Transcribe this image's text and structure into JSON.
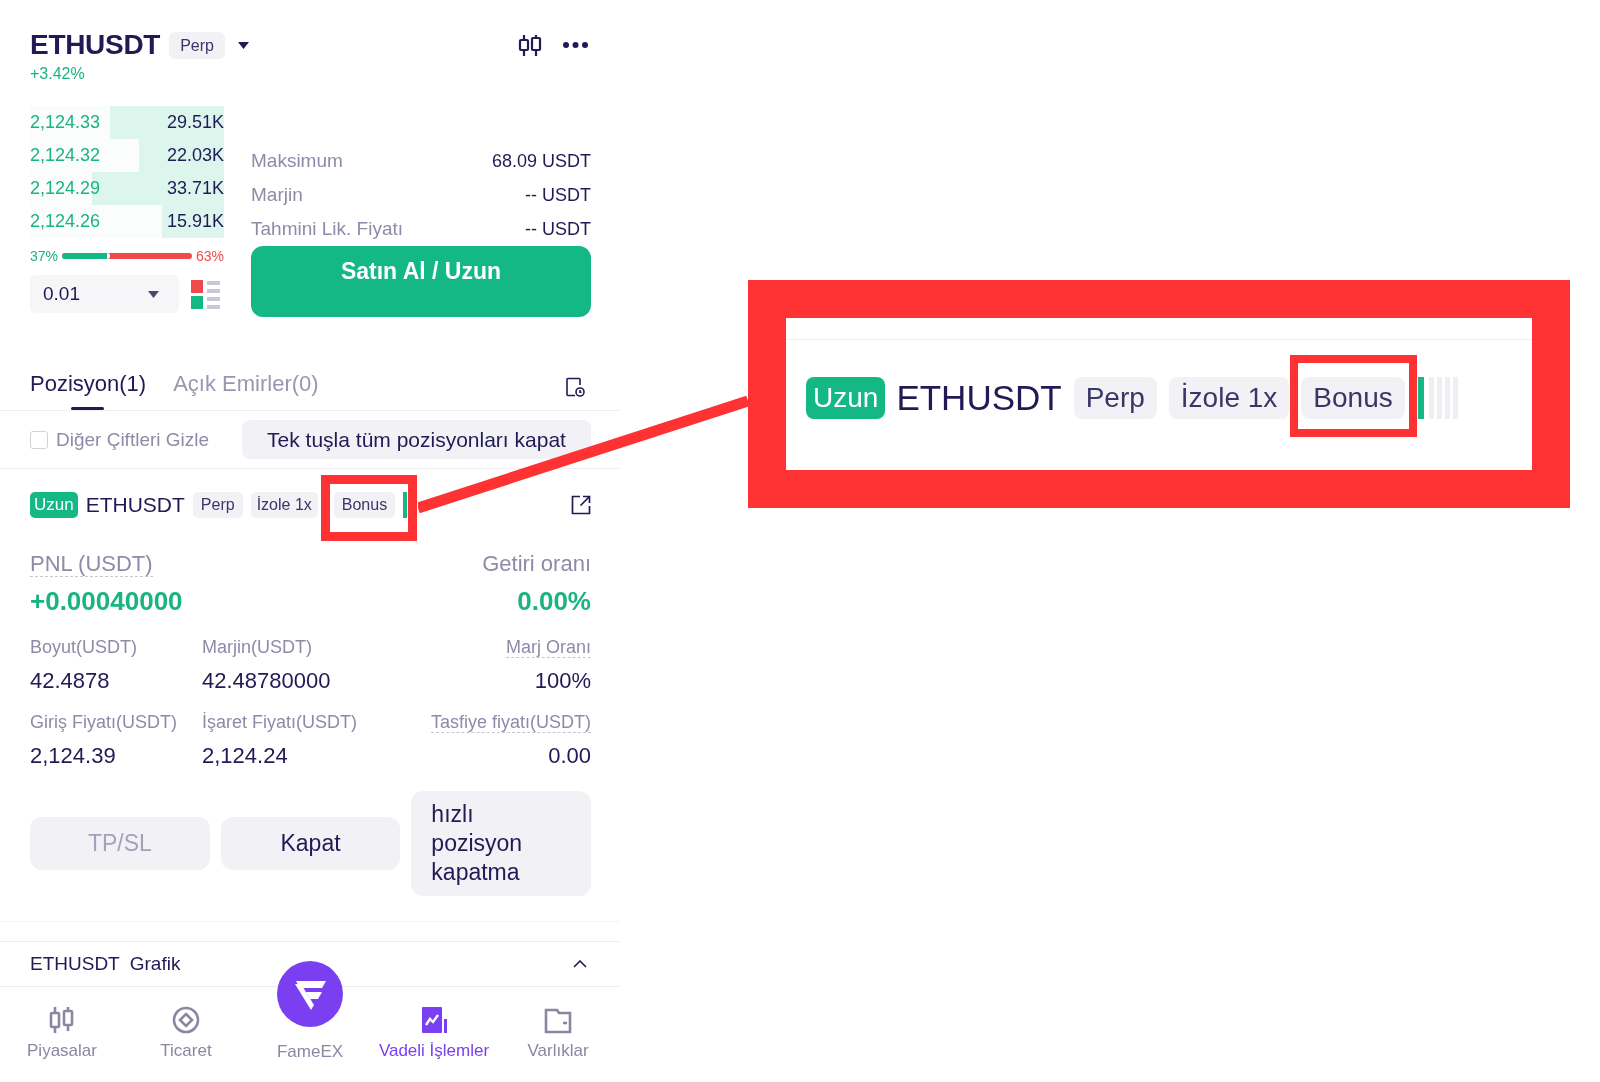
{
  "header": {
    "symbol": "ETHUSDT",
    "contract_tag": "Perp",
    "change": "+3.42%"
  },
  "order_book": {
    "rows": [
      {
        "price": "2,124.33",
        "amount": "29.51K",
        "level": 0.59
      },
      {
        "price": "2,124.32",
        "amount": "22.03K",
        "level": 0.44
      },
      {
        "price": "2,124.29",
        "amount": "33.71K",
        "level": 0.68
      },
      {
        "price": "2,124.26",
        "amount": "15.91K",
        "level": 0.32
      }
    ],
    "buy_share": "37%",
    "ratio_bar": {
      "level": 0.37
    },
    "sell_share": "63%",
    "precision": "0.01"
  },
  "order_form": {
    "rows": [
      {
        "label": "Maksimum",
        "value": "68.09 USDT"
      },
      {
        "label": "Marjin",
        "value": "-- USDT"
      },
      {
        "label": "Tahmini Lik. Fiyatı",
        "value": "-- USDT"
      }
    ],
    "submit_button": "Satın Al / Uzun"
  },
  "tabs": [
    {
      "label": "Pozisyon(1)",
      "selected": true
    },
    {
      "label": "Açık Emirler(0)",
      "selected": false
    }
  ],
  "hide_other_pairs": {
    "label": "Diğer Çiftleri Gizle",
    "checked": false
  },
  "close_all_button": "Tek tuşla tüm pozisyonları kapat",
  "position": {
    "side": "Uzun",
    "symbol": "ETHUSDT",
    "tags": [
      {
        "label": "Perp",
        "highlighted": false
      },
      {
        "label": "İzole 1x",
        "highlighted": false
      },
      {
        "label": "Bonus",
        "highlighted": true
      }
    ],
    "pnl": {
      "label": "PNL (USDT)",
      "underlined": true,
      "value": "+0.00040000"
    },
    "roi": {
      "label": "Getiri oranı",
      "underlined": false,
      "value": "0.00%"
    },
    "fields": [
      {
        "label": "Boyut(USDT)",
        "value": "42.4878",
        "underlined": false
      },
      {
        "label": "Marjin(USDT)",
        "value": "42.48780000",
        "underlined": false
      },
      {
        "label": "Marj Oranı",
        "value": "100%",
        "underlined": true
      },
      {
        "label": "Giriş Fiyatı(USDT)",
        "value": "2,124.39",
        "underlined": false
      },
      {
        "label": "İşaret Fiyatı(USDT)",
        "value": "2,124.24",
        "underlined": false
      },
      {
        "label": "Tasfiye fiyatı(USDT)",
        "value": "0.00",
        "underlined": true
      }
    ],
    "buttons": [
      {
        "label": "TP/SL",
        "disabled": true
      },
      {
        "label": "Kapat",
        "disabled": false
      },
      {
        "label": "hızlı pozisyon kapatma",
        "disabled": false
      }
    ]
  },
  "chart_panel": {
    "symbol": "ETHUSDT",
    "label": "Grafik"
  },
  "bottom_nav": [
    {
      "label": "Piyasalar",
      "kind": "tab",
      "selected": false
    },
    {
      "label": "Ticaret",
      "kind": "tab",
      "selected": false
    },
    {
      "label": "FameEX",
      "kind": "logo",
      "selected": false
    },
    {
      "label": "Vadeli İşlemler",
      "kind": "tab",
      "selected": true
    },
    {
      "label": "Varlıklar",
      "kind": "tab",
      "selected": false
    }
  ],
  "callout": {
    "side": "Uzun",
    "symbol": "ETHUSDT",
    "tags": [
      {
        "label": "Perp",
        "highlighted": false
      },
      {
        "label": "İzole 1x",
        "highlighted": false
      },
      {
        "label": "Bonus",
        "highlighted": true
      }
    ]
  }
}
